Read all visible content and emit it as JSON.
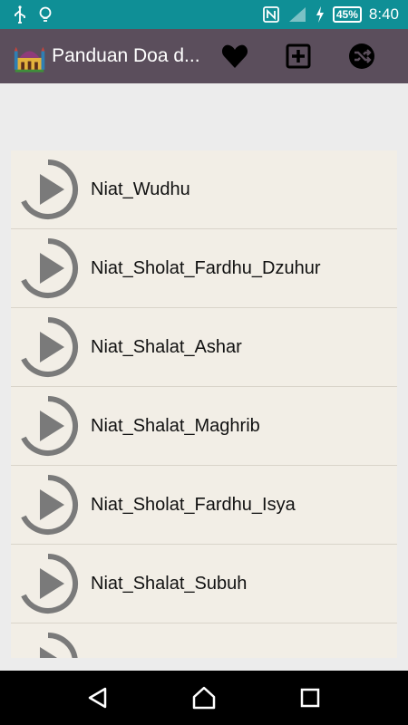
{
  "status_bar": {
    "battery": "45%",
    "time": "8:40",
    "icons": [
      "usb-icon",
      "bulb-icon",
      "nfc-icon",
      "signal-icon",
      "charging-icon",
      "battery-icon"
    ]
  },
  "app_bar": {
    "title": "Panduan Doa d...",
    "actions": [
      "heart-icon",
      "add-box-icon",
      "shuffle-icon"
    ]
  },
  "list": {
    "items": [
      {
        "label": "Niat_Wudhu"
      },
      {
        "label": "Niat_Sholat_Fardhu_Dzuhur"
      },
      {
        "label": "Niat_Shalat_Ashar"
      },
      {
        "label": "Niat_Shalat_Maghrib"
      },
      {
        "label": "Niat_Sholat_Fardhu_Isya"
      },
      {
        "label": "Niat_Shalat_Subuh"
      },
      {
        "label": ""
      }
    ]
  },
  "nav_bar": {
    "buttons": [
      "back-icon",
      "home-icon",
      "recents-icon"
    ]
  },
  "colors": {
    "status_bar": "#0f8f96",
    "app_bar": "#5b4e5c",
    "list_bg": "#f2eee6",
    "icon_gray": "#7a7a7a"
  }
}
